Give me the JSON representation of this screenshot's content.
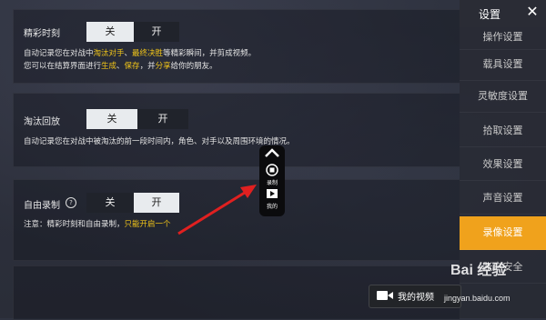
{
  "sidebar": {
    "title": "设置",
    "items": [
      {
        "label": "操作设置",
        "active": false
      },
      {
        "label": "载具设置",
        "active": false
      },
      {
        "label": "灵敏度设置",
        "active": false
      },
      {
        "label": "拾取设置",
        "active": false
      },
      {
        "label": "效果设置",
        "active": false
      },
      {
        "label": "声音设置",
        "active": false
      },
      {
        "label": "录像设置",
        "active": true
      },
      {
        "label": "账户安全",
        "active": false
      }
    ]
  },
  "settings": {
    "highlight": {
      "title": "精彩时刻",
      "off": "关",
      "on": "开",
      "selected": "off",
      "desc1_a": "自动记录您在对战中",
      "desc1_b": "淘汰对手",
      "desc1_c": "、",
      "desc1_d": "最终决胜",
      "desc1_e": "等精彩瞬间，并剪成视频。",
      "desc2_a": "您可以在结算界面进行",
      "desc2_b": "生成",
      "desc2_c": "、",
      "desc2_d": "保存",
      "desc2_e": "，并",
      "desc2_f": "分享",
      "desc2_g": "给你的朋友。"
    },
    "elimination": {
      "title": "淘汰回放",
      "off": "关",
      "on": "开",
      "selected": "off",
      "desc": "自动记录您在对战中被淘汰的前一段时间内，角色、对手以及周围环境的情况。"
    },
    "free_record": {
      "title": "自由录制",
      "off": "关",
      "on": "开",
      "selected": "on",
      "help": "?",
      "note_a": "注意：精彩时刻和自由录制，",
      "note_b": "只能开启一个"
    }
  },
  "float_widget": {
    "record_label": "录制",
    "mine_label": "我的"
  },
  "video_button": {
    "label": "我的视频"
  },
  "watermark": {
    "brand": "Bai 经验",
    "url": "jingyan.baidu.com"
  },
  "colors": {
    "accent": "#f0a21c",
    "highlight_text": "#f0c419",
    "arrow": "#e02020"
  }
}
